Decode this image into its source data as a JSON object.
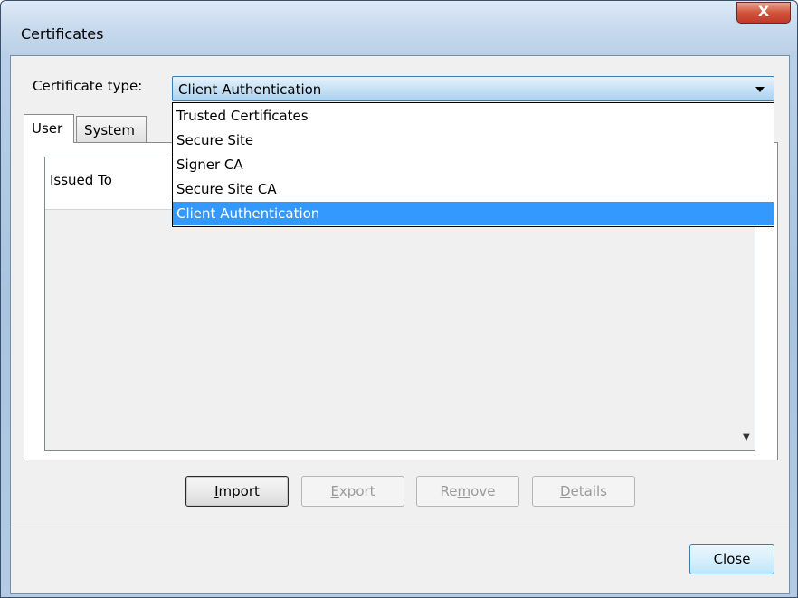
{
  "window": {
    "title": "Certificates",
    "close_glyph": "X"
  },
  "cert_type": {
    "label": "Certificate type:",
    "value": "Client Authentication",
    "options": [
      "Trusted Certificates",
      "Secure Site",
      "Signer CA",
      "Secure Site CA",
      "Client Authentication"
    ]
  },
  "tabs": [
    {
      "label": "User",
      "active": true
    },
    {
      "label": "System",
      "active": false
    }
  ],
  "list": {
    "column_header": "Issued To"
  },
  "buttons": {
    "import": {
      "pre": "",
      "mn": "I",
      "post": "mport"
    },
    "export": {
      "pre": "",
      "mn": "E",
      "post": "xport"
    },
    "remove": {
      "pre": "Re",
      "mn": "m",
      "post": "ove"
    },
    "details": {
      "pre": "",
      "mn": "D",
      "post": "etails"
    },
    "close": "Close"
  }
}
